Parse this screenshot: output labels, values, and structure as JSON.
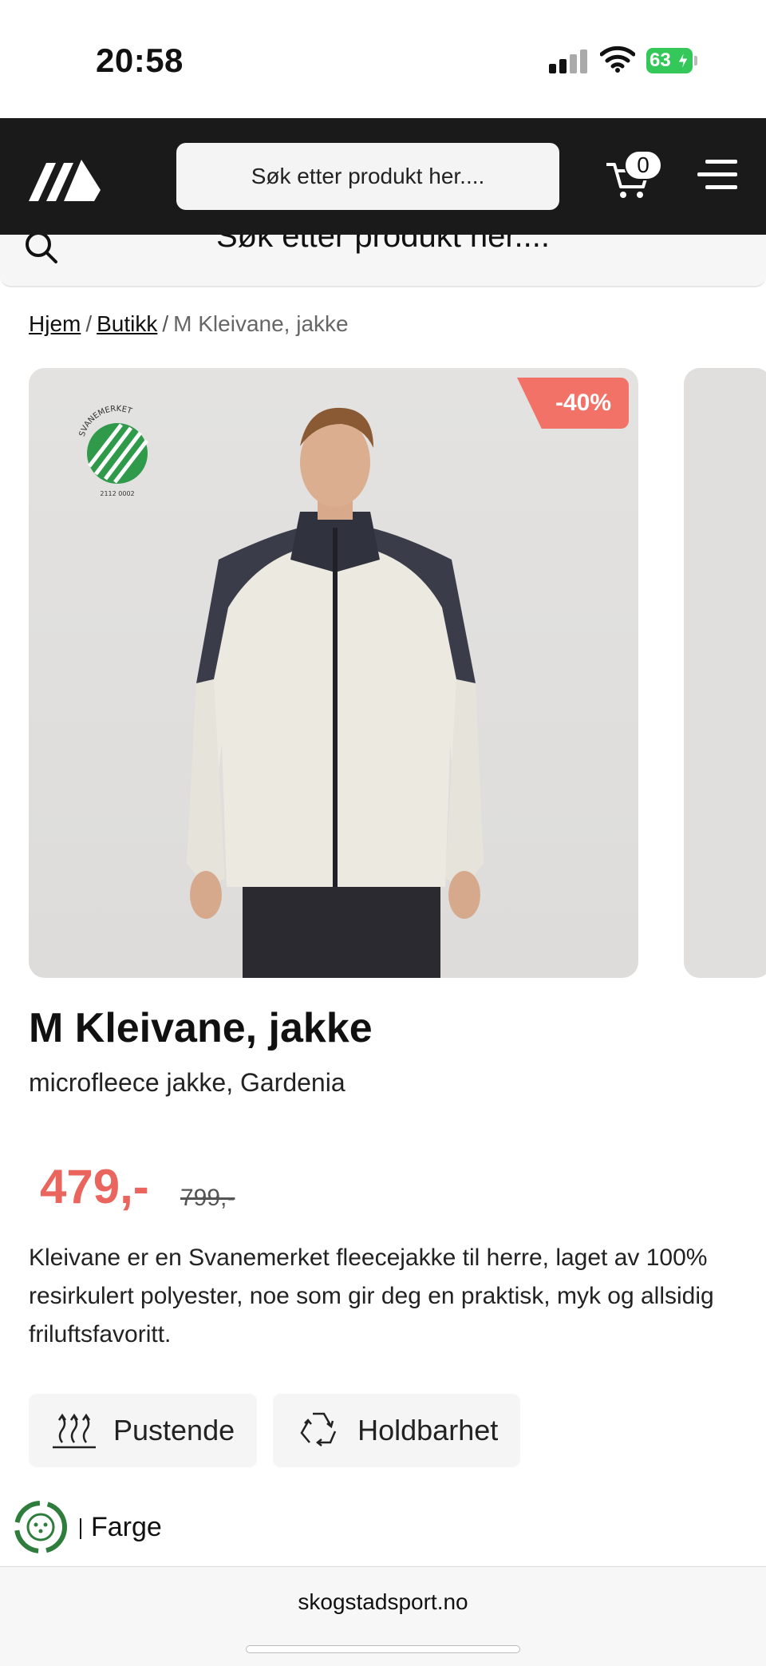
{
  "status_bar": {
    "time": "20:58",
    "battery": "63"
  },
  "header": {
    "search_placeholder": "Søk etter produkt her....",
    "cart_count": "0"
  },
  "sticky_search": {
    "placeholder": "Søk etter produkt her...."
  },
  "breadcrumb": {
    "items": [
      "Hjem",
      "Butikk"
    ],
    "current": "M Kleivane, jakke",
    "separator": "/"
  },
  "gallery": {
    "discount": "-40%",
    "ecolabel_text": [
      "SVANEMERKET",
      "2112 0002"
    ]
  },
  "product": {
    "title": "M Kleivane, jakke",
    "subtitle": "microfleece jakke, Gardenia",
    "price": "479,-",
    "old_price": "799,-",
    "description": "Kleivane er en Svanemerket fleecejakke til herre, laget av 100% resirkulert polyester, noe som gir deg en praktisk, myk og allsidig friluftsfavoritt."
  },
  "features": [
    {
      "icon": "breathable-icon",
      "label": "Pustende"
    },
    {
      "icon": "recycle-icon",
      "label": "Holdbarhet"
    }
  ],
  "color": {
    "label": "Farge"
  },
  "browser": {
    "url": "skogstadsport.no"
  },
  "colors": {
    "header_bg": "#1a1a1a",
    "accent": "#f27268",
    "price": "#e9655d",
    "battery": "#34c759"
  }
}
